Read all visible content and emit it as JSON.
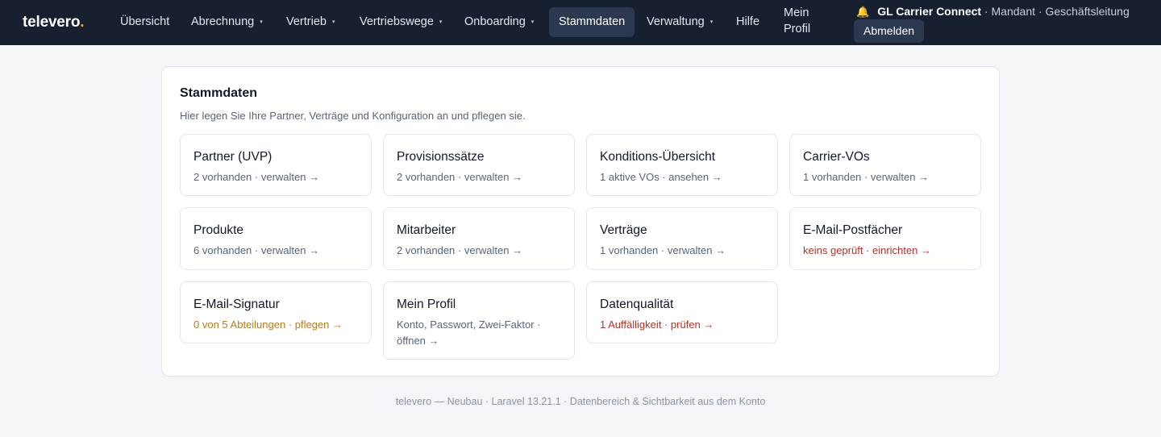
{
  "brand": {
    "name": "televero",
    "dot": "."
  },
  "nav": {
    "items": [
      {
        "label": "Übersicht",
        "dropdown": false
      },
      {
        "label": "Abrechnung",
        "dropdown": true
      },
      {
        "label": "Vertrieb",
        "dropdown": true
      },
      {
        "label": "Vertriebswege",
        "dropdown": true
      },
      {
        "label": "Onboarding",
        "dropdown": true
      },
      {
        "label": "Stammdaten",
        "dropdown": false,
        "active": true
      },
      {
        "label": "Verwaltung",
        "dropdown": true
      },
      {
        "label": "Hilfe",
        "dropdown": false
      }
    ],
    "caret": "▾",
    "profile_label": "Mein Profil"
  },
  "tenant": {
    "icon": "bell-icon",
    "bell_glyph": "🔔",
    "name": "GL Carrier Connect",
    "detail": " · Mandant · Geschäftsleitung",
    "logout_label": "Abmelden"
  },
  "main": {
    "title": "Stammdaten",
    "subtitle": "Hier legen Sie Ihre Partner, Verträge und Konfiguration an und pflegen sie.",
    "cards": [
      {
        "title": "Partner (UVP)",
        "meta": "2 vorhanden · verwalten →",
        "tone": "normal"
      },
      {
        "title": "Provisionssätze",
        "meta": "2 vorhanden · verwalten →",
        "tone": "normal"
      },
      {
        "title": "Konditions-Übersicht",
        "meta": "1 aktive VOs · ansehen →",
        "tone": "normal"
      },
      {
        "title": "Carrier-VOs",
        "meta": "1 vorhanden · verwalten →",
        "tone": "normal"
      },
      {
        "title": "Produkte",
        "meta": "6 vorhanden · verwalten →",
        "tone": "normal"
      },
      {
        "title": "Mitarbeiter",
        "meta": "2 vorhanden · verwalten →",
        "tone": "normal"
      },
      {
        "title": "Verträge",
        "meta": "1 vorhanden · verwalten →",
        "tone": "normal"
      },
      {
        "title": "E-Mail-Postfächer",
        "meta": "keins geprüft · einrichten →",
        "tone": "danger"
      },
      {
        "title": "E-Mail-Signatur",
        "meta": "0 von 5 Abteilungen · pflegen →",
        "tone": "warn"
      },
      {
        "title": "Mein Profil",
        "meta": "Konto, Passwort, Zwei-Faktor · öffnen →",
        "tone": "normal"
      },
      {
        "title": "Datenqualität",
        "meta": "1 Auffälligkeit · prüfen →",
        "tone": "danger"
      }
    ]
  },
  "footer": {
    "text": "televero — Neubau · Laravel 13.21.1 · Datenbereich & Sichtbarkeit aus dem Konto"
  },
  "colors": {
    "nav_bg": "#172030",
    "accent": "#f0a030",
    "danger": "#b3322a",
    "warn": "#b47c22"
  }
}
